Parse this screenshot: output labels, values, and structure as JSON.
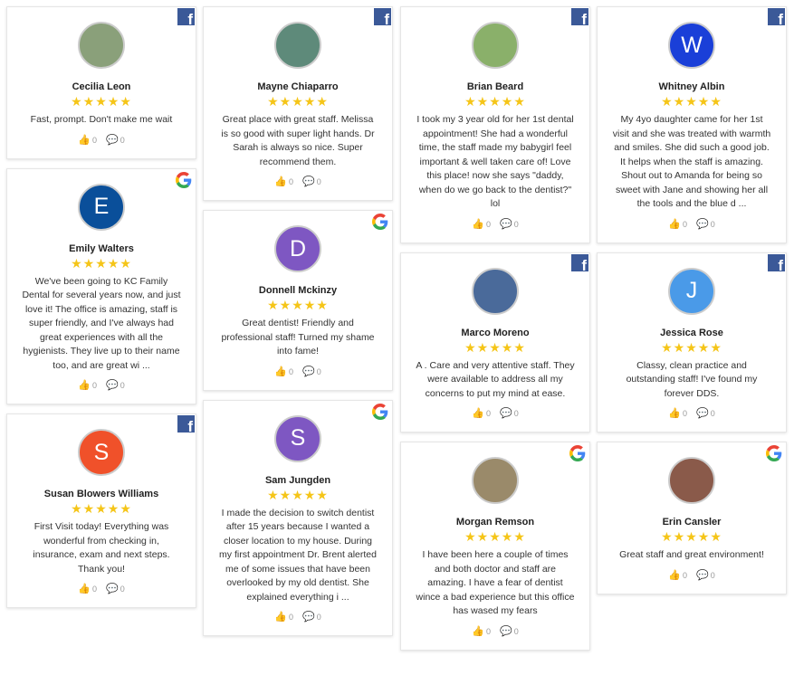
{
  "reviews": [
    {
      "name": "Cecilia Leon",
      "source": "facebook",
      "avatar": {
        "type": "photo",
        "initial": "",
        "color": "#8aa07a"
      },
      "stars": "★★★★★",
      "text": "Fast, prompt. Don't make me wait",
      "likes": "0",
      "comments": "0"
    },
    {
      "name": "Emily Walters",
      "source": "google",
      "avatar": {
        "type": "initial",
        "initial": "E",
        "color": "#0a4f9a"
      },
      "stars": "★★★★★",
      "text": "We've been going to KC Family Dental for several years now, and just love it! The office is amazing, staff is super friendly, and I've always had great experiences with all the hygienists. They live up to their name too, and are great wi ...",
      "likes": "0",
      "comments": "0"
    },
    {
      "name": "Susan Blowers Williams",
      "source": "facebook",
      "avatar": {
        "type": "initial",
        "initial": "S",
        "color": "#f0512a"
      },
      "stars": "★★★★★",
      "text": "First Visit today! Everything was wonderful from checking in, insurance, exam and next steps. Thank you!",
      "likes": "0",
      "comments": "0"
    },
    {
      "name": "Mayne Chiaparro",
      "source": "facebook",
      "avatar": {
        "type": "photo",
        "initial": "",
        "color": "#5e8a7a"
      },
      "stars": "★★★★★",
      "text": "Great place with great staff. Melissa is so good with super light hands. Dr Sarah is always so nice. Super recommend them.",
      "likes": "0",
      "comments": "0"
    },
    {
      "name": "Donnell Mckinzy",
      "source": "google",
      "avatar": {
        "type": "initial",
        "initial": "D",
        "color": "#7e57c2"
      },
      "stars": "★★★★★",
      "text": "Great dentist! Friendly and professional staff! Turned my shame into fame!",
      "likes": "0",
      "comments": "0"
    },
    {
      "name": "Sam Jungden",
      "source": "google",
      "avatar": {
        "type": "initial",
        "initial": "S",
        "color": "#7e57c2"
      },
      "stars": "★★★★★",
      "text": "I made the decision to switch dentist after 15 years because I wanted a closer location to my house. During my first appointment Dr. Brent alerted me of some issues that have been overlooked by my old dentist. She explained everything i ...",
      "likes": "0",
      "comments": "0"
    },
    {
      "name": "Brian Beard",
      "source": "facebook",
      "avatar": {
        "type": "photo",
        "initial": "",
        "color": "#8ab06a"
      },
      "stars": "★★★★★",
      "text": "I took my 3 year old for her 1st dental appointment! She had a wonderful time, the staff made my babygirl feel important & well taken care of! Love this place! now she says \"daddy, when do we go back to the dentist?\" lol",
      "likes": "0",
      "comments": "0"
    },
    {
      "name": "Marco Moreno",
      "source": "facebook",
      "avatar": {
        "type": "photo",
        "initial": "",
        "color": "#4a6a9a"
      },
      "stars": "★★★★★",
      "text": "A . Care and very attentive staff. They were available to address all my concerns to put my mind at ease.",
      "likes": "0",
      "comments": "0"
    },
    {
      "name": "Morgan Remson",
      "source": "google",
      "avatar": {
        "type": "photo",
        "initial": "",
        "color": "#9a8a6a"
      },
      "stars": "★★★★★",
      "text": "I have been here a couple of times and both doctor and staff are amazing. I have a fear of dentist wince a bad experience but this office has wased my fears",
      "likes": "0",
      "comments": "0"
    },
    {
      "name": "Whitney Albin",
      "source": "facebook",
      "avatar": {
        "type": "initial",
        "initial": "W",
        "color": "#1a3fd8"
      },
      "stars": "★★★★★",
      "text": "My 4yo daughter came for her 1st visit and she was treated with warmth and smiles. She did such a good job. It helps when the staff is amazing. Shout out to Amanda for being so sweet with Jane and showing her all the tools and the blue d ...",
      "likes": "0",
      "comments": "0"
    },
    {
      "name": "Jessica Rose",
      "source": "facebook",
      "avatar": {
        "type": "initial",
        "initial": "J",
        "color": "#4a9ae8"
      },
      "stars": "★★★★★",
      "text": "Classy, clean practice and outstanding staff! I've found my forever DDS.",
      "likes": "0",
      "comments": "0"
    },
    {
      "name": "Erin Cansler",
      "source": "google",
      "avatar": {
        "type": "photo",
        "initial": "",
        "color": "#8a5a4a"
      },
      "stars": "★★★★★",
      "text": "Great staff and great environment!",
      "likes": "0",
      "comments": "0"
    }
  ],
  "colors": {
    "facebook": "#3b5998",
    "star": "#f5c518"
  },
  "icons": {
    "like": "thumbs-up-icon",
    "comment": "comment-icon",
    "facebook": "facebook-icon",
    "google": "google-icon"
  }
}
